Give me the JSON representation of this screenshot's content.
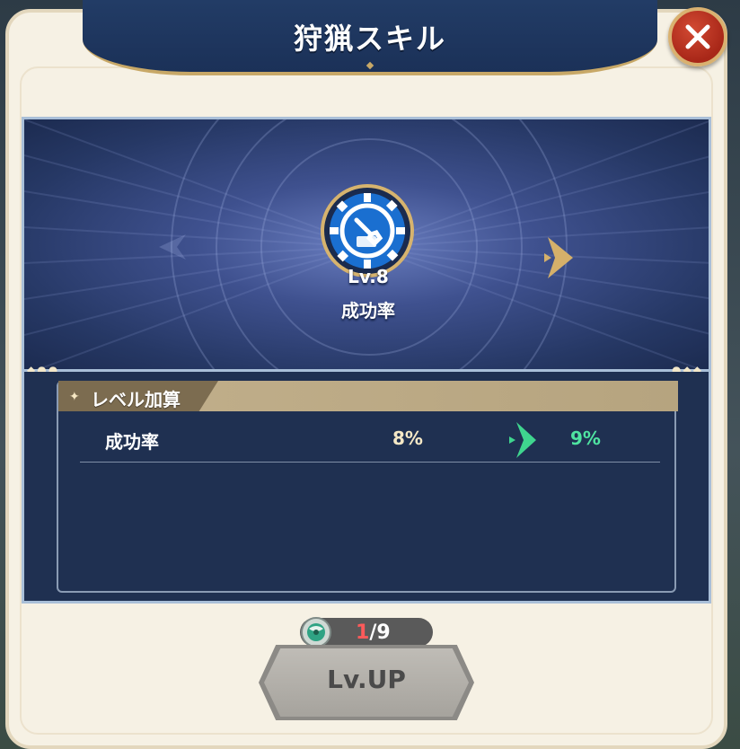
{
  "window": {
    "title": "狩猟スキル"
  },
  "close_button": {
    "icon": "close-icon"
  },
  "skill": {
    "level_label": "Lv.8",
    "name": "成功率",
    "icon": "wrench-gear-icon"
  },
  "bonus_section": {
    "header": "レベル加算",
    "rows": [
      {
        "label": "成功率",
        "current": "8%",
        "next": "9%"
      }
    ]
  },
  "cost": {
    "have": "1",
    "need": "/9",
    "icon": "orb-item-icon"
  },
  "level_up_button": {
    "label": "Lv.UP",
    "state": "disabled"
  },
  "colors": {
    "panel": "#f6f1e4",
    "banner": "#1f3760",
    "accent_gold": "#c8a867",
    "next_value": "#4fe3a1",
    "insufficient": "#ff5a5a"
  }
}
